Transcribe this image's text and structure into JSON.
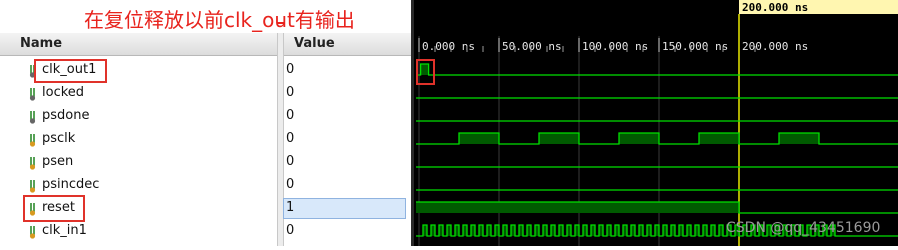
{
  "annotation": {
    "text": "在复位释放以前clk_out有输出"
  },
  "columns": {
    "name": "Name",
    "value": "Value"
  },
  "signals": [
    {
      "name": "clk_out1",
      "value": "0",
      "icon": "wire-output-icon"
    },
    {
      "name": "locked",
      "value": "0",
      "icon": "wire-output-icon"
    },
    {
      "name": "psdone",
      "value": "0",
      "icon": "wire-output-icon"
    },
    {
      "name": "psclk",
      "value": "0",
      "icon": "wire-input-icon"
    },
    {
      "name": "psen",
      "value": "0",
      "icon": "wire-input-icon"
    },
    {
      "name": "psincdec",
      "value": "0",
      "icon": "wire-input-icon"
    },
    {
      "name": "reset",
      "value": "1",
      "icon": "wire-input-icon",
      "selected": true
    },
    {
      "name": "clk_in1",
      "value": "0",
      "icon": "wire-input-icon"
    }
  ],
  "timeline": {
    "ticks": [
      "0.000 ns",
      "50.000 ns",
      "100.000 ns",
      "150.000 ns",
      "200.000 ns"
    ],
    "cursor_label": "200.000 ns"
  },
  "watermark": "CSDN @qq_43451690",
  "colors": {
    "wave": "#00e000",
    "wave_fill": "#005a00",
    "cursor": "#e8e800",
    "annotation": "#e8231d",
    "grid": "#3a3a3a"
  }
}
